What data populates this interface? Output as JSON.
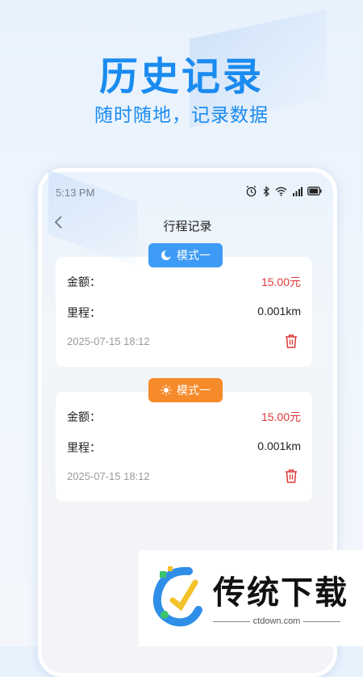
{
  "promo": {
    "headline": "历史记录",
    "subline": "随时随地，记录数据"
  },
  "status_bar": {
    "time": "5:13 PM",
    "icons": [
      "alarm-icon",
      "bluetooth-icon",
      "wifi-icon",
      "signal-icon",
      "battery-icon"
    ]
  },
  "nav": {
    "back_icon": "chevron-left-icon",
    "title": "行程记录"
  },
  "records": [
    {
      "mode_label": "模式一",
      "mode_icon": "moon-icon",
      "badge_color": "#3d9bf6",
      "amount_label": "金额：",
      "amount_value": "15.00元",
      "distance_label": "里程：",
      "distance_value": "0.001km",
      "date": "2025-07-15 18:12"
    },
    {
      "mode_label": "模式一",
      "mode_icon": "sun-icon",
      "badge_color": "#f78a2a",
      "amount_label": "金额：",
      "amount_value": "15.00元",
      "distance_label": "里程：",
      "distance_value": "0.001km",
      "date": "2025-07-15 18:12"
    }
  ],
  "watermark": {
    "brand": "传统下载",
    "site": "ctdown.com"
  },
  "colors": {
    "accent": "#1a8bf0",
    "amount_red": "#e0393a"
  }
}
